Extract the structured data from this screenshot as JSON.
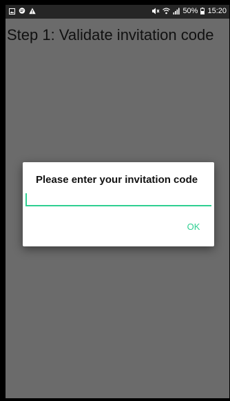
{
  "status_bar": {
    "battery_percent": "50%",
    "time": "15:20",
    "left_icons": [
      "gallery-icon",
      "message-icon",
      "warning-icon"
    ],
    "right_icons": [
      "mute-icon",
      "wifi-icon",
      "signal-icon",
      "battery-icon"
    ]
  },
  "page": {
    "title": "Step 1: Validate invitation code"
  },
  "dialog": {
    "title": "Please enter your invitation code",
    "input_value": "",
    "ok_label": "OK"
  },
  "colors": {
    "accent": "#2ecf91",
    "screen_background": "#6b6b6b",
    "status_bar": "#262626"
  }
}
